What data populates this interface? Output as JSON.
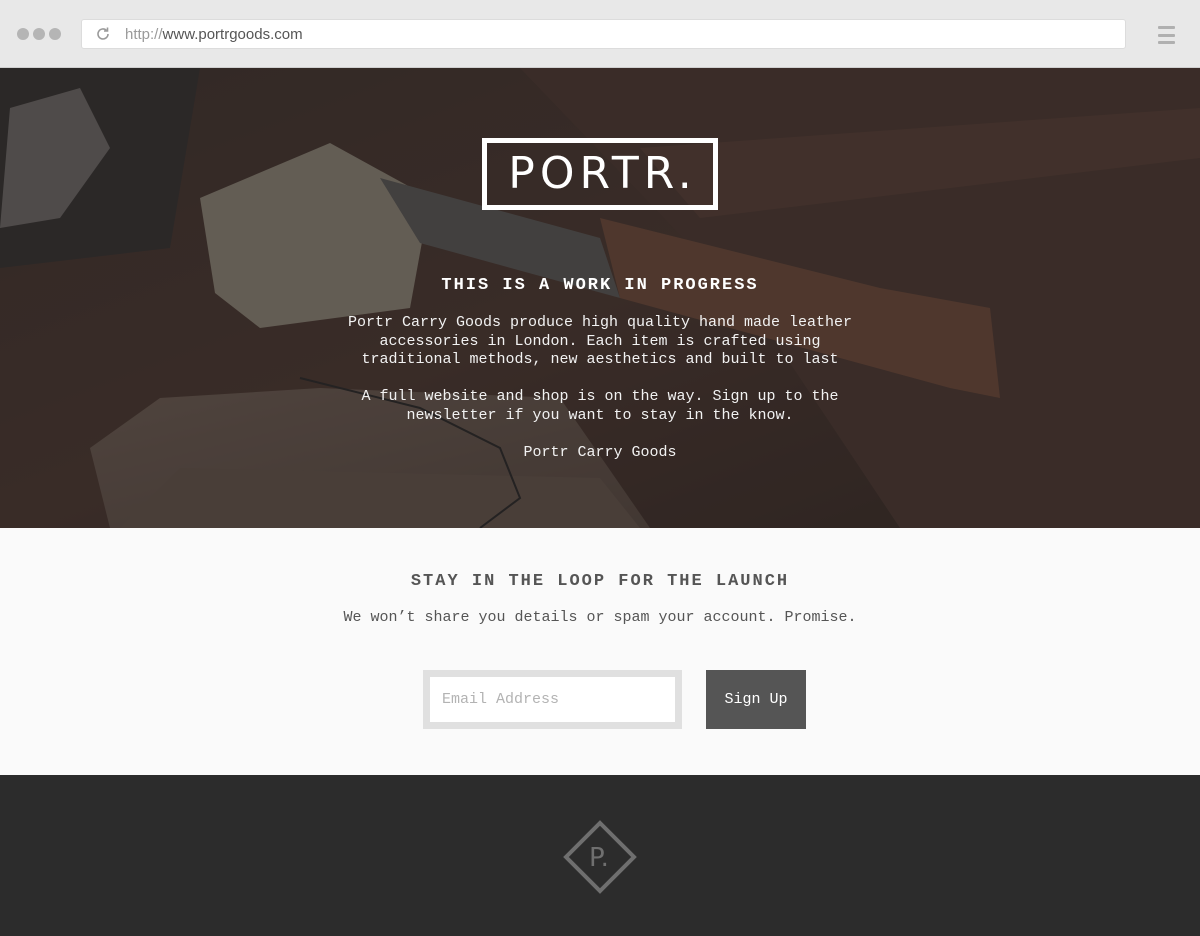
{
  "browser": {
    "url_protocol": "http://",
    "url_host": "www.portrgoods.com",
    "reload_icon": "reload-icon",
    "menu_icon": "hamburger-menu-icon"
  },
  "hero": {
    "logo": "PORTR.",
    "title": "THIS IS A WORK IN PROGRESS",
    "paragraph1": "Portr Carry Goods produce high quality hand made leather accessories in London. Each item is crafted using traditional methods, new aesthetics and built to last",
    "paragraph2": "A full website and shop is on the way. Sign up to the newsletter if you want to stay in the know.",
    "signature": "Portr Carry Goods"
  },
  "newsletter": {
    "title": "STAY IN THE LOOP FOR THE LAUNCH",
    "subtitle": "We won’t share you details or spam your account. Promise.",
    "email_placeholder": "Email Address",
    "email_value": "",
    "signup_label": "Sign Up"
  },
  "footer": {
    "logo_mark": "P."
  },
  "colors": {
    "chrome": "#e8e8e8",
    "newsletter_bg": "#fafafa",
    "button": "#555555",
    "footer_bg": "#2c2c2c",
    "footer_logo": "#6f6f6f"
  }
}
